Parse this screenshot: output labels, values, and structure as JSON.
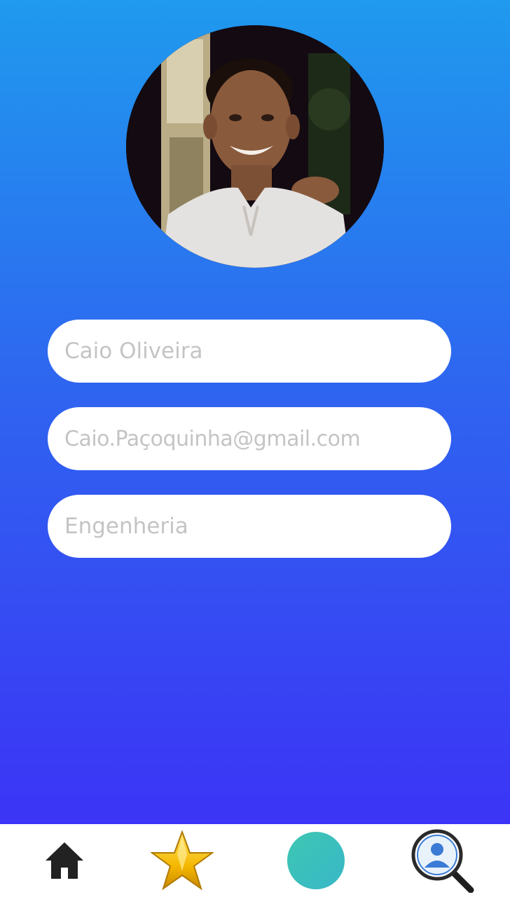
{
  "profile": {
    "name_placeholder": "Caio Oliveira",
    "email_placeholder": "Caio.Paçoquinha@gmail.com",
    "course_placeholder": "Engenheria"
  },
  "nav": {
    "items": [
      {
        "icon": "home-icon"
      },
      {
        "icon": "star-icon"
      },
      {
        "icon": "circle-icon"
      },
      {
        "icon": "user-search-icon"
      }
    ]
  },
  "colors": {
    "gradient_top": "#1f9aee",
    "gradient_bottom": "#3e2cf7",
    "field_background": "#ffffff",
    "placeholder_text": "#c4c4c4",
    "nav_background": "#ffffff",
    "circle_teal": "#3cc4b4",
    "star_gold": "#f5b800"
  }
}
